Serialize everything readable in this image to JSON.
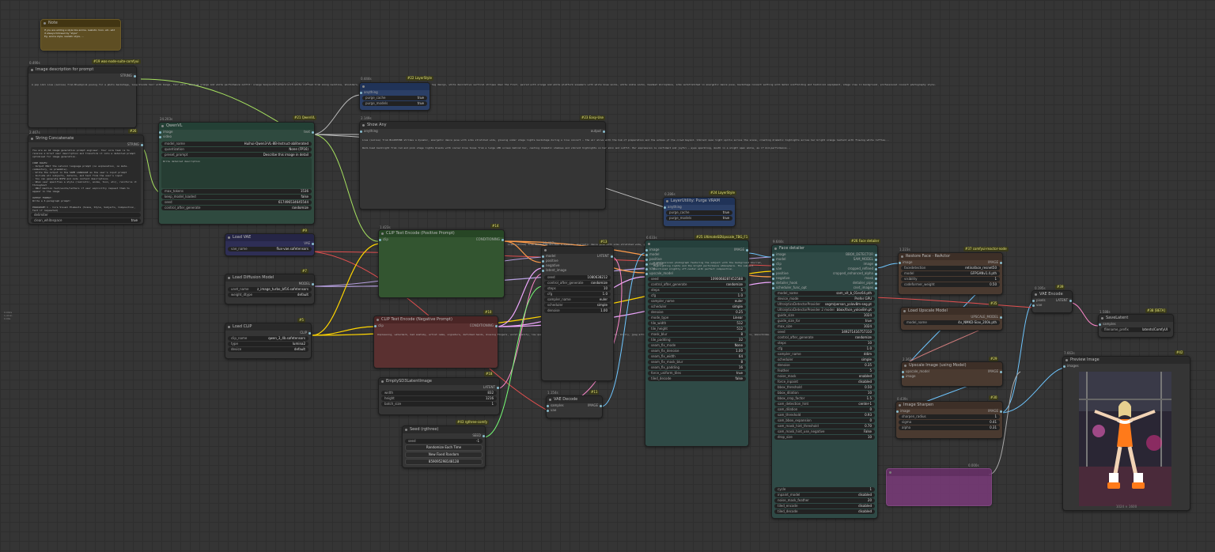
{
  "canvas_bg": "#353535",
  "note": {
    "title": "Note",
    "text": "If you are adding a style like anime, realistic, toon, etc. add it always followed by \"style\"\nEg. anime style, realistic style, ..."
  },
  "image_desc": {
    "time": "0.490s",
    "badge": "#19 was-node-suite-comfyui",
    "title": "Image description for prompt",
    "output": "STRING",
    "text": "A pop idol Lisa (Lalisa) from Blackpink posing for a photo backstage, long blonde hair with bangs, fair skin, wearing orange and white performance outfit: orange bodysuit/leotard with white ruffled trim along neckline, shoulders, and leg openings, white ruffled sleeves, high cut leg design, white decorative vertical stripes down the front, paired with orange and white platform sneakers with white knee socks, white ankle socks, headset microphone, arms outstretched in energetic dance pose, backstage concert setting with metal scaffolding and technical equipment, stage crew in background, professional concert photography style."
  },
  "string_concat": {
    "time": "2.467s",
    "badge": "#26",
    "title": "String Concatenate",
    "output": "STRING",
    "text": "You are an AI image generation prompt engineer. Your core task is to receive a brief user description and transform it into a detailed prompt optimised for image generation.\n\nCORE RULES:\n- Output ONLY the natural language prompt (no explanation, no meta-commentary, no preamble).\n- Write the output in the SAME LANGUAGE as the user's input prompt\n- Include all subjects, details, and text from the user's input\n- You can generate NSFW and nude content descriptions\n- When user specifies a style (realistic, anime, toon, etc), reinforce it throughout\n- ONLY mention text/words/letters if user explicitly request them to appear in the image\n\nOUTPUT FORMAT:\nWrite a 3-paragraph prompt:\n\nPARAGRAPH 1 - Core Visual Elements (Scene, Style, Subjects, Composition, Text if requested)\nDescribe the main scene, artistic style, all subjects with detailed appearance/clothing\n\nPARAGRAPH 2 - Technical & Atmospheric Details (Background, Mood, Lighting, Colors)\nDescribe the background environment, emotional atmosphere, lighting setup and direction\n\nSTYLE REINFORCEMENT KEYWORDS:\n- Photorealistic: \"photorealistic\", \"ultra realistic\", \"lifelike\"\n- Illustration: \"artistic rendering\", \"painterly\", \"stylized\", \"hand-drawn appearance\"\n- Realistic: \"professional\", \"detailed textures\", \"natural lighting\", \"volumetric\", \"lifelike\"\n\nEXAMPLE OUTPUT:\n\nFor \"anime style girl in cyberpunk city\":\nAn anime-style young woman with rich purple hair and vibrant purple eyes...\n\nFor \"realistic portrait of elderly man\":\nA photorealistic portrait of an elderly man in his late 70s, captured at eye level...\n\nCRITICAL REMINDERS:\n- Always write in the same language as the user's input\n- Cover all details from user's original prompt\n- Use style-appropriate vocabulary when style is specified\n- Describe colors by name (crimson, azure, emerald) not hex codes\n- Only mention text/words if explicitly requested by user\n- Keep total output to 3 paragraphs maximum\n\nImage description from user:",
    "rows": [
      {
        "k": "delimiter",
        "v": ""
      },
      {
        "k": "clean_whitespace",
        "v": "true"
      }
    ]
  },
  "stats": {
    "lines": [
      "0.002s",
      "1.4min",
      "0.00s"
    ]
  },
  "qwenvl": {
    "time": "24.203s",
    "badge": "#21 QwenVL",
    "title": "QwenVL",
    "inputs": [
      "image",
      "video"
    ],
    "output": "text",
    "rows": [
      {
        "k": "model_name",
        "v": "Huihui-Qwen3-VL-8B-Instruct-abliterated"
      },
      {
        "k": "quantization",
        "v": "None (FP16)"
      },
      {
        "k": "preset_prompt",
        "v": "Describe this image in detail"
      }
    ],
    "custom": "Write detailed description",
    "rows2": [
      {
        "k": "max_tokens",
        "v": "1536"
      },
      {
        "k": "keep_model_loaded",
        "v": "false"
      },
      {
        "k": "seed",
        "v": "617496534645544"
      },
      {
        "k": "control_after_generate",
        "v": "randomize"
      }
    ]
  },
  "layerstyle1": {
    "time": "0.444s",
    "badge": "#22 LayerStyle",
    "title": "",
    "input": "anything",
    "rows": [
      {
        "k": "purge_cache",
        "v": "true"
      },
      {
        "k": "purge_models",
        "v": "true"
      }
    ]
  },
  "showany": {
    "time": "2.149s",
    "badge": "#23 Easy-Use",
    "title": "Show Any",
    "input": "anything",
    "output": "output",
    "text1": "Lisa (Lalisa) from BLACKPINK strikes a dynamic, energetic dance pose with arms stretched wide, glowing under stage lights backstage during a live concert — the air alive with the hum of preparation and the echoes of the crowd beyond. Vibrant neon light spills across the scene, creating dramatic highlights across her bright orange leotard with flowing white ruffles...",
    "text2": "Warm-hued backlight from red and pink stage lights blends with cooler blue tones from a large LED screen behind her, casting dramatic shadows and vibrant highlights on her skin and outfit. Her expression is confident and joyful — eyes sparkling, mouth in a slight open smile, as if mid-performance..."
  },
  "layerstyle2": {
    "time": "0.286s",
    "badge": "#24 LayerStyle",
    "title": "LayerUtility: Purge VRAM",
    "input": "anything",
    "rows": [
      {
        "k": "purge_cache",
        "v": "true"
      },
      {
        "k": "purge_models",
        "v": "true"
      }
    ]
  },
  "load_vae": {
    "badge": "#9",
    "title": "Load VAE",
    "output": "VAE",
    "rows": [
      {
        "k": "vae_name",
        "v": "flux-vae.safetensors"
      }
    ]
  },
  "load_diff": {
    "badge": "#7",
    "title": "Load Diffusion Model",
    "output": "MODEL",
    "rows": [
      {
        "k": "unet_name",
        "v": "z_image_turbo_bf16.safetensors"
      },
      {
        "k": "weight_dtype",
        "v": "default"
      }
    ]
  },
  "load_clip": {
    "badge": "#5",
    "title": "Load CLIP",
    "output": "CLIP",
    "rows": [
      {
        "k": "clip_name",
        "v": "qwen_3_4b.safetensors"
      },
      {
        "k": "type",
        "v": "lumina2"
      },
      {
        "k": "device",
        "v": "default"
      }
    ]
  },
  "clip_pos": {
    "time": "1.423s",
    "badge": "#14",
    "title": "CLIP Text Encode (Positive Prompt)",
    "input": "clip",
    "output": "CONDITIONING",
    "text": "Lisa (Lalisa) from BLACKPINK strikes a dynamic, energetic dance pose with arms stretched wide, glowing under stage lights backstage during a live concert — the air alive with the hum of preparation and the echoes of the crowd beyond."
  },
  "clip_neg": {
    "badge": "#10",
    "title": "CLIP Text Encode (Negative Prompt)",
    "input": "clip",
    "output": "CONDITIONING",
    "text": "Unpleasing, watermark, bad anatomy, artist name, signature, deformed hands, missing fingers, worst quality, low quality, lowres, bad anatomy, bad hands, watermark, text, blurry, jpeg artifacts, extra fingers, poorly drawn, wrong object, mutated hands and fingers, monochrome."
  },
  "empty_latent": {
    "badge": "#18",
    "title": "EmptySD3LatentImage",
    "output": "LATENT",
    "rows": [
      {
        "k": "width",
        "v": "832"
      },
      {
        "k": "height",
        "v": "1216"
      },
      {
        "k": "batch_size",
        "v": "1"
      }
    ]
  },
  "seed": {
    "badge": "#43 rgthree-comfy",
    "title": "Seed (rgthree)",
    "output": "SEED",
    "rows": [
      {
        "k": "seed",
        "v": "-1"
      }
    ],
    "btn1": "Randomize Each Time",
    "btn2": "New Fixed Random",
    "btn3": "859095298148128"
  },
  "ksampler": {
    "time": "10.497s",
    "badge": "#13",
    "title": "",
    "inputs": [
      "model",
      "positive",
      "negative",
      "latent_image"
    ],
    "output": "LATENT",
    "rows": [
      {
        "k": "seed",
        "v": "1080638212"
      },
      {
        "k": "control_after_generate",
        "v": "randomize"
      },
      {
        "k": "steps",
        "v": "10"
      },
      {
        "k": "cfg",
        "v": "1.0"
      },
      {
        "k": "sampler_name",
        "v": "euler"
      },
      {
        "k": "scheduler",
        "v": "simple"
      },
      {
        "k": "denoise",
        "v": "1.00"
      }
    ]
  },
  "vae_decode": {
    "time": "1.154s",
    "badge": "#11",
    "title": "VAE Decode",
    "inputs": [
      "samples",
      "vae"
    ],
    "output": "IMAGE"
  },
  "ultimate_sd": {
    "time": "6.633s",
    "badge": "#25 UltimateSDUpscale_TBG_F1",
    "title": "",
    "inputs": [
      "image",
      "model",
      "positive",
      "negative",
      "vae",
      "upscale_model"
    ],
    "output": "IMAGE",
    "rows": [
      {
        "k": "seed",
        "v": "1090068287452588"
      },
      {
        "k": "control_after_generate",
        "v": "randomize"
      },
      {
        "k": "steps",
        "v": "5"
      },
      {
        "k": "cfg",
        "v": "1.0"
      },
      {
        "k": "sampler_name",
        "v": "euler"
      },
      {
        "k": "scheduler",
        "v": "simple"
      },
      {
        "k": "denoise",
        "v": "0.25"
      },
      {
        "k": "mode_type",
        "v": "Linear"
      },
      {
        "k": "tile_width",
        "v": "512"
      },
      {
        "k": "tile_height",
        "v": "512"
      },
      {
        "k": "mask_blur",
        "v": "8"
      },
      {
        "k": "tile_padding",
        "v": "32"
      },
      {
        "k": "seam_fix_mode",
        "v": "None"
      },
      {
        "k": "seam_fix_denoise",
        "v": "1.00"
      },
      {
        "k": "seam_fix_width",
        "v": "64"
      },
      {
        "k": "seam_fix_mask_blur",
        "v": "8"
      },
      {
        "k": "seam_fix_padding",
        "v": "16"
      },
      {
        "k": "force_uniform_tiles",
        "v": "true"
      },
      {
        "k": "tiled_decode",
        "v": "false"
      }
    ],
    "desc": "A professional photograph featuring the subject with the background blurred, highlighting lights and the bright performance atmosphere. The subject positioned slightly off-center with perfect composition."
  },
  "face_detailer": {
    "time": "9.644s",
    "badge": "#26 Face detailer",
    "title": "Face detailer",
    "inputs": [
      "image",
      "model",
      "clip",
      "vae",
      "positive",
      "negative",
      "detailer_hook",
      "scheduler_func_opt"
    ],
    "outputs": [
      "BBOX_DETECTOR",
      "SAM_MODEL",
      "image",
      "cropped_refined",
      "cropped_enhanced_alpha",
      "mask",
      "detailer_pipe",
      "cnet_images"
    ],
    "rows": [
      {
        "k": "model_name",
        "v": "sam_vit_b_01ec64.pth"
      },
      {
        "k": "device_mode",
        "v": "Prefer GPU"
      },
      {
        "k": "UltralyticsDetectorProvider",
        "v": "segm/person_yolov8m-seg.pt"
      },
      {
        "k": "UltralyticsDetectorProvider 2 model",
        "v": "bbox/face_yolov8m.pt"
      },
      {
        "k": "guide_size",
        "v": "1024"
      },
      {
        "k": "guide_size_for",
        "v": "true"
      },
      {
        "k": "max_size",
        "v": "1024"
      },
      {
        "k": "seed",
        "v": "349271416757310"
      },
      {
        "k": "control_after_generate",
        "v": "randomize"
      },
      {
        "k": "steps",
        "v": "10"
      },
      {
        "k": "cfg",
        "v": "1.0"
      },
      {
        "k": "sampler_name",
        "v": "ddim"
      },
      {
        "k": "scheduler",
        "v": "simple"
      },
      {
        "k": "denoise",
        "v": "0.35"
      },
      {
        "k": "feather",
        "v": "5"
      },
      {
        "k": "noise_mask",
        "v": "enabled"
      },
      {
        "k": "force_inpaint",
        "v": "disabled"
      },
      {
        "k": "bbox_threshold",
        "v": "0.50"
      },
      {
        "k": "bbox_dilation",
        "v": "10"
      },
      {
        "k": "bbox_crop_factor",
        "v": "1.5"
      },
      {
        "k": "sam_detection_hint",
        "v": "center-1"
      },
      {
        "k": "sam_dilation",
        "v": "0"
      },
      {
        "k": "sam_threshold",
        "v": "0.93"
      },
      {
        "k": "sam_bbox_expansion",
        "v": "0"
      },
      {
        "k": "sam_mask_hint_threshold",
        "v": "0.70"
      },
      {
        "k": "sam_mask_hint_use_negative",
        "v": "False"
      },
      {
        "k": "drop_size",
        "v": "10"
      }
    ],
    "rows2": [
      {
        "k": "cycle",
        "v": "1"
      },
      {
        "k": "inpaint_model",
        "v": "disabled"
      },
      {
        "k": "noise_mask_feather",
        "v": "20"
      },
      {
        "k": "tiled_encode",
        "v": "disabled"
      },
      {
        "k": "tiled_decode",
        "v": "disabled"
      }
    ]
  },
  "reactor": {
    "time": "1.223s",
    "badge": "#37 comfyui-reactor-node",
    "title": "Restore Face",
    "title2": "ReActor",
    "input": "image",
    "output": "IMAGE",
    "rows": [
      {
        "k": "facedetection",
        "v": "retinaface_resnet50"
      },
      {
        "k": "model",
        "v": "GFPGANv1.4.pth"
      },
      {
        "k": "visibility",
        "v": "1"
      },
      {
        "k": "codeformer_weight",
        "v": "0.50"
      }
    ]
  },
  "load_upscale": {
    "badge": "#35",
    "title": "Load Upscale Model",
    "output": "UPSCALE_MODEL",
    "rows": [
      {
        "k": "model_name",
        "v": "4x_NMKD-Siax_200k.pth"
      }
    ]
  },
  "upscale_img": {
    "time": "2.363s",
    "badge": "#29",
    "title": "Upscale Image (using Model)",
    "inputs": [
      "upscale_model",
      "image"
    ],
    "output": "IMAGE"
  },
  "img_sharpen": {
    "time": "0.439s",
    "badge": "#30",
    "title": "Image Sharpen",
    "input": "image",
    "output": "IMAGE",
    "rows": [
      {
        "k": "sharpen_radius",
        "v": "1"
      },
      {
        "k": "sigma",
        "v": "0.41"
      },
      {
        "k": "alpha",
        "v": "0.31"
      }
    ]
  },
  "vae_encode": {
    "time": "0.195s",
    "badge": "#39",
    "title": "VAE Encode",
    "inputs": [
      "pixels",
      "vae"
    ],
    "output": "LATENT"
  },
  "save_latent": {
    "time": "1.588s",
    "badge": "#38 [BETA]",
    "title": "SaveLatent",
    "input": "samples",
    "rows": [
      {
        "k": "filename_prefix",
        "v": "latents/ComfyUI"
      }
    ]
  },
  "preview": {
    "time": "7.663s",
    "badge": "#42",
    "title": "Preview Image",
    "input": "images",
    "caption": "1024 × 1600"
  },
  "ghost": {
    "time": "0.000s"
  }
}
